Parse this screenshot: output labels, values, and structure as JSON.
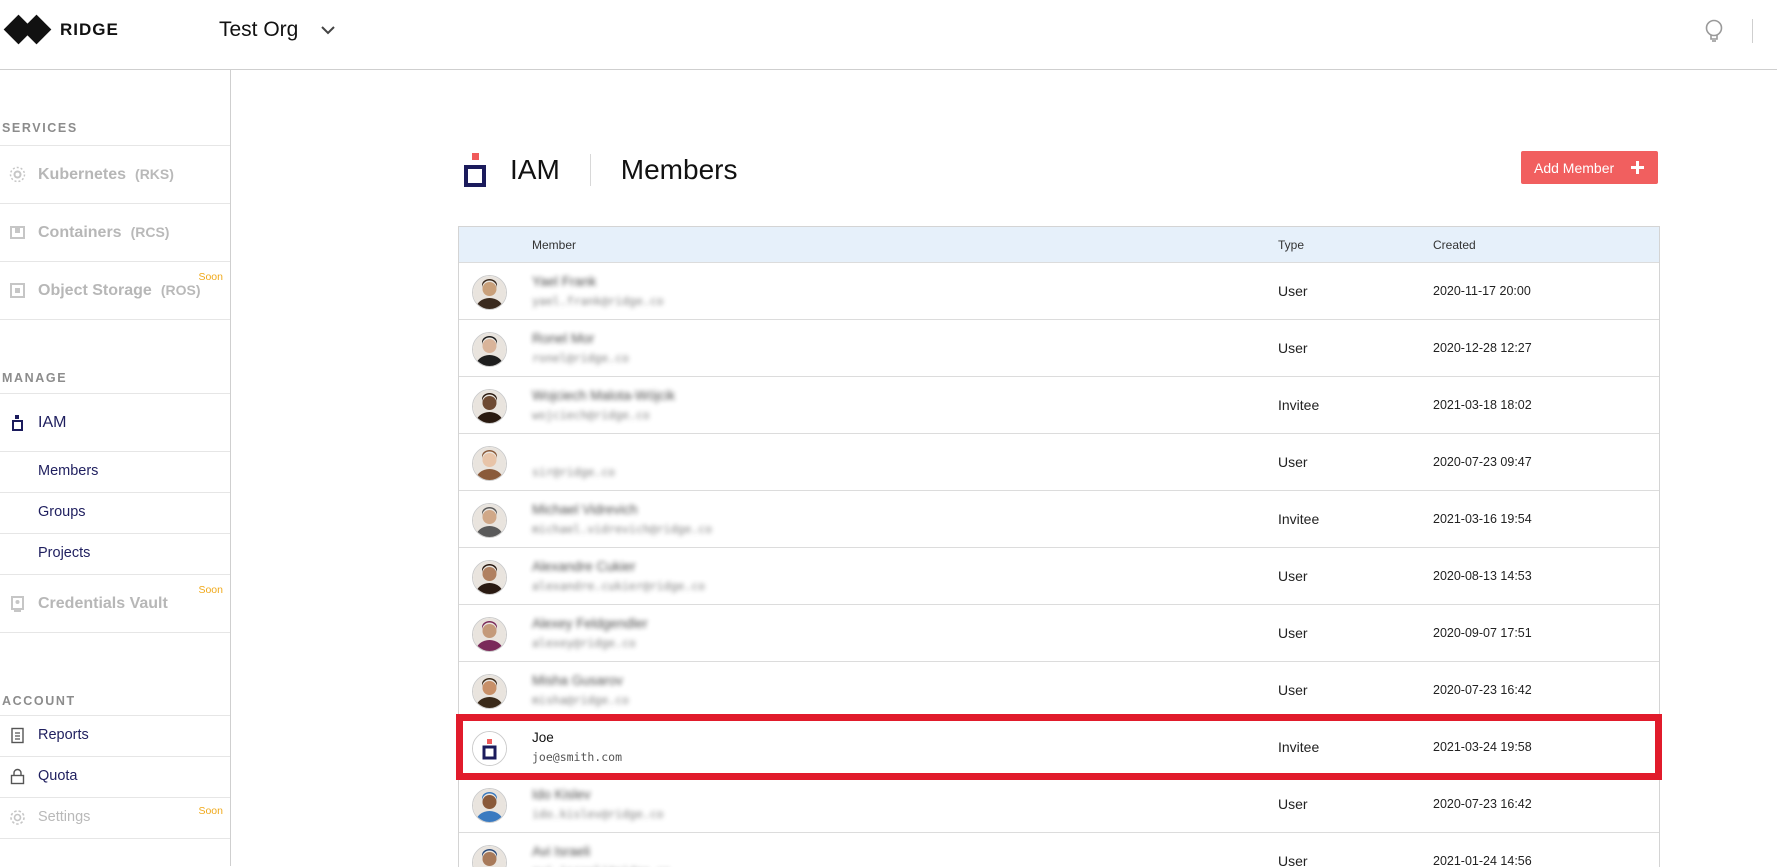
{
  "app": {
    "logo_text": "RIDGE",
    "org_name": "Test Org"
  },
  "sidebar": {
    "services_title": "SERVICES",
    "services": [
      {
        "label": "Kubernetes",
        "sub": "(RKS)",
        "soon": ""
      },
      {
        "label": "Containers",
        "sub": "(RCS)",
        "soon": ""
      },
      {
        "label": "Object Storage",
        "sub": "(ROS)",
        "soon": "Soon"
      }
    ],
    "manage_title": "MANAGE",
    "iam_label": "IAM",
    "iam_items": [
      "Members",
      "Groups",
      "Projects"
    ],
    "vault": {
      "label": "Credentials Vault",
      "soon": "Soon"
    },
    "account_title": "ACCOUNT",
    "account": [
      {
        "label": "Reports",
        "soon": ""
      },
      {
        "label": "Quota",
        "soon": ""
      },
      {
        "label": "Settings",
        "soon": "Soon"
      }
    ]
  },
  "main": {
    "section": "IAM",
    "title": "Members",
    "add_button": "Add Member",
    "columns": {
      "member": "Member",
      "type": "Type",
      "created": "Created"
    },
    "rows": [
      {
        "name": "Yael Frank",
        "email": "yael.frank@ridge.co",
        "type": "User",
        "created": "2020-11-17 20:00"
      },
      {
        "name": "Ronel Mor",
        "email": "ronel@ridge.co",
        "type": "User",
        "created": "2020-12-28 12:27"
      },
      {
        "name": "Wojciech Malota-Wójcik",
        "email": "wojciech@ridge.co",
        "type": "Invitee",
        "created": "2021-03-18 18:02"
      },
      {
        "name": "",
        "email": "sir@ridge.co",
        "type": "User",
        "created": "2020-07-23 09:47"
      },
      {
        "name": "Michael Vidrevich",
        "email": "michael.vidrevich@ridge.co",
        "type": "Invitee",
        "created": "2021-03-16 19:54"
      },
      {
        "name": "Alexandre Cukier",
        "email": "alexandre.cukier@ridge.co",
        "type": "User",
        "created": "2020-08-13 14:53"
      },
      {
        "name": "Alexey Feldgendler",
        "email": "alexey@ridge.co",
        "type": "User",
        "created": "2020-09-07 17:51"
      },
      {
        "name": "Misha Gusarov",
        "email": "misha@ridge.co",
        "type": "User",
        "created": "2020-07-23 16:42"
      },
      {
        "name": "Joe",
        "email": "joe@smith.com",
        "type": "Invitee",
        "created": "2021-03-24 19:58"
      },
      {
        "name": "Ido Kislev",
        "email": "ido.kislev@ridge.co",
        "type": "User",
        "created": "2020-07-23 16:42"
      },
      {
        "name": "Avi Israeli",
        "email": "avi.israeli@ridge.co",
        "type": "User",
        "created": "2021-01-24 14:56"
      }
    ]
  },
  "colors": {
    "accent": "#f15f5f",
    "navy": "#1b1b5c",
    "soon": "#f0a91b",
    "highlight": "#e11b2b",
    "header_bg": "#e6f0fa"
  }
}
